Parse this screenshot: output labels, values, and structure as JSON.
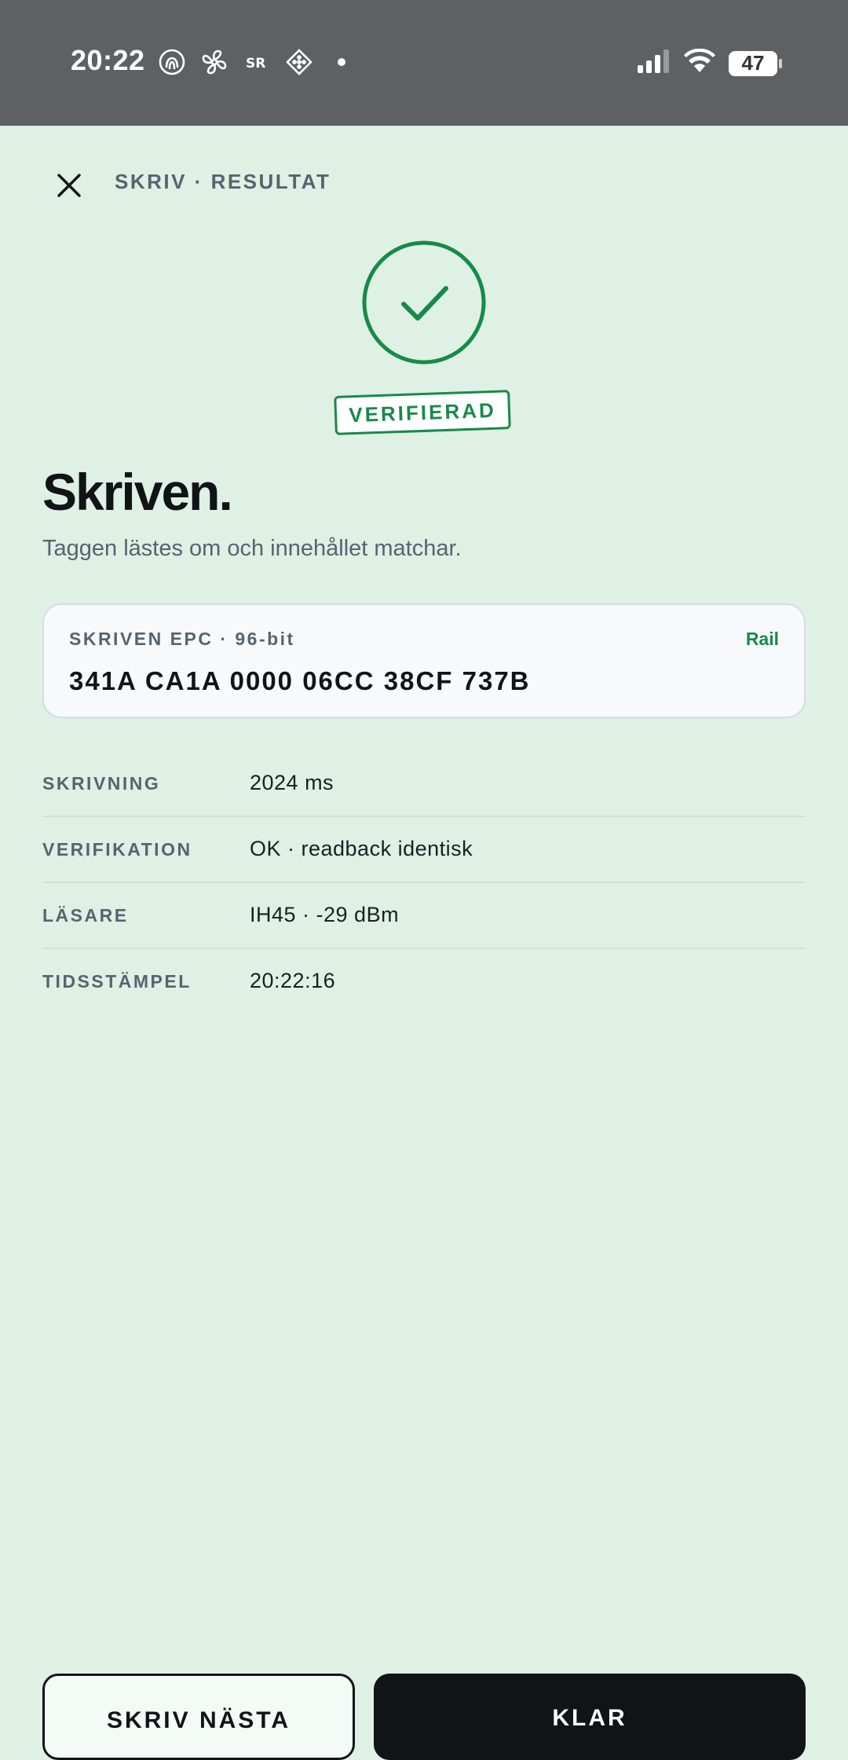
{
  "status_bar": {
    "time": "20:22",
    "battery": "47",
    "left_icons": [
      "fingerprint-icon",
      "fan-icon",
      "sr-icon",
      "diamond-grid-icon",
      "dot-icon"
    ],
    "right_icons": [
      "signal-icon",
      "wifi-icon",
      "battery-icon"
    ]
  },
  "header": {
    "title": "SKRIV · RESULTAT",
    "close_icon": "close-icon"
  },
  "result": {
    "status_icon": "check-circle-icon",
    "badge": "VERIFIERAD",
    "headline": "Skriven.",
    "subtitle": "Taggen lästes om och innehållet matchar."
  },
  "epc_card": {
    "label": "SKRIVEN EPC · 96-bit",
    "tag": "Rail",
    "value": "341A CA1A 0000 06CC 38CF 737B"
  },
  "details": [
    {
      "key": "SKRIVNING",
      "value": "2024 ms"
    },
    {
      "key": "VERIFIKATION",
      "value": "OK · readback identisk"
    },
    {
      "key": "LÄSARE",
      "value": "IH45 · -29 dBm"
    },
    {
      "key": "TIDSSTÄMPEL",
      "value": "20:22:16"
    }
  ],
  "actions": {
    "secondary": "SKRIV NÄSTA",
    "primary": "KLAR"
  },
  "colors": {
    "background": "#dff0e4",
    "accent": "#178a4a",
    "status_bar": "#5f6064",
    "text": "#111417",
    "muted": "#566470"
  }
}
